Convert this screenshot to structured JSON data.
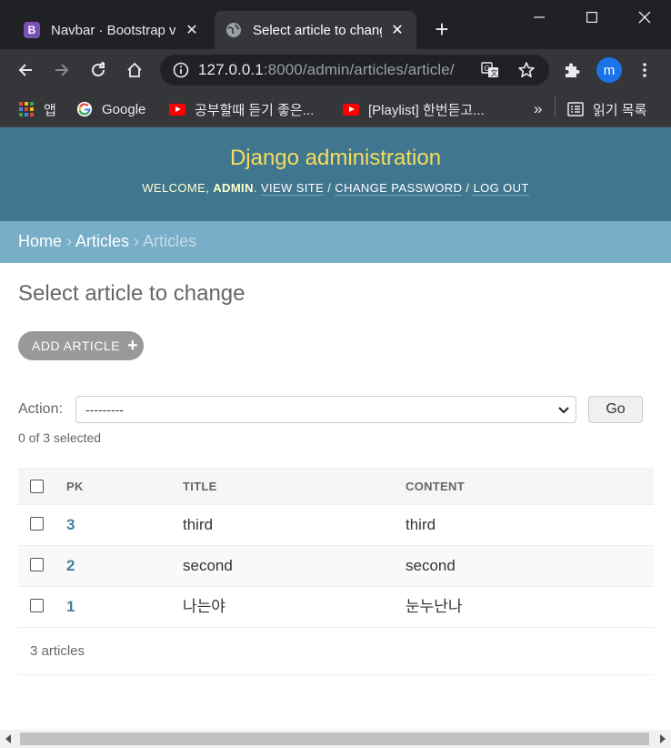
{
  "browser": {
    "tabs": [
      {
        "title": "Navbar · Bootstrap v5",
        "favicon": "B",
        "favicon_color": "#7952b3",
        "active": false
      },
      {
        "title": "Select article to change",
        "favicon": "globe-icon",
        "active": true
      }
    ],
    "url_host": "127.0.0.1",
    "url_rest": ":8000/admin/articles/article/",
    "profile_initial": "m",
    "bookmarks": {
      "apps": "앱",
      "google": "Google",
      "item1": "공부할때 듣기 좋은...",
      "item2": "[Playlist] 한번듣고...",
      "more": "»",
      "reading_list": "읽기 목록"
    }
  },
  "admin": {
    "site_title": "Django administration",
    "welcome": "Welcome,",
    "username": "admin",
    "view_site": "View site",
    "change_password": "Change password",
    "log_out": "Log out",
    "separator": "/"
  },
  "breadcrumbs": {
    "home": "Home",
    "app": "Articles",
    "current": "Articles",
    "sep": "›"
  },
  "page": {
    "title": "Select article to change",
    "add_button": "Add article",
    "action_label": "Action:",
    "action_value": "---------",
    "go_button": "Go",
    "selected_count": "0 of 3 selected"
  },
  "table": {
    "headers": {
      "pk": "PK",
      "title": "TITLE",
      "content": "CONTENT"
    },
    "rows": [
      {
        "pk": "3",
        "title": "third",
        "content": "third"
      },
      {
        "pk": "2",
        "title": "second",
        "content": "second"
      },
      {
        "pk": "1",
        "title": "나는야",
        "content": "눈누난나"
      }
    ],
    "count_text": "3 articles"
  },
  "colors": {
    "header_bg": "#417690",
    "branding": "#f5dd5d",
    "breadcrumbs_bg": "#79aec8",
    "link": "#447e9b"
  }
}
